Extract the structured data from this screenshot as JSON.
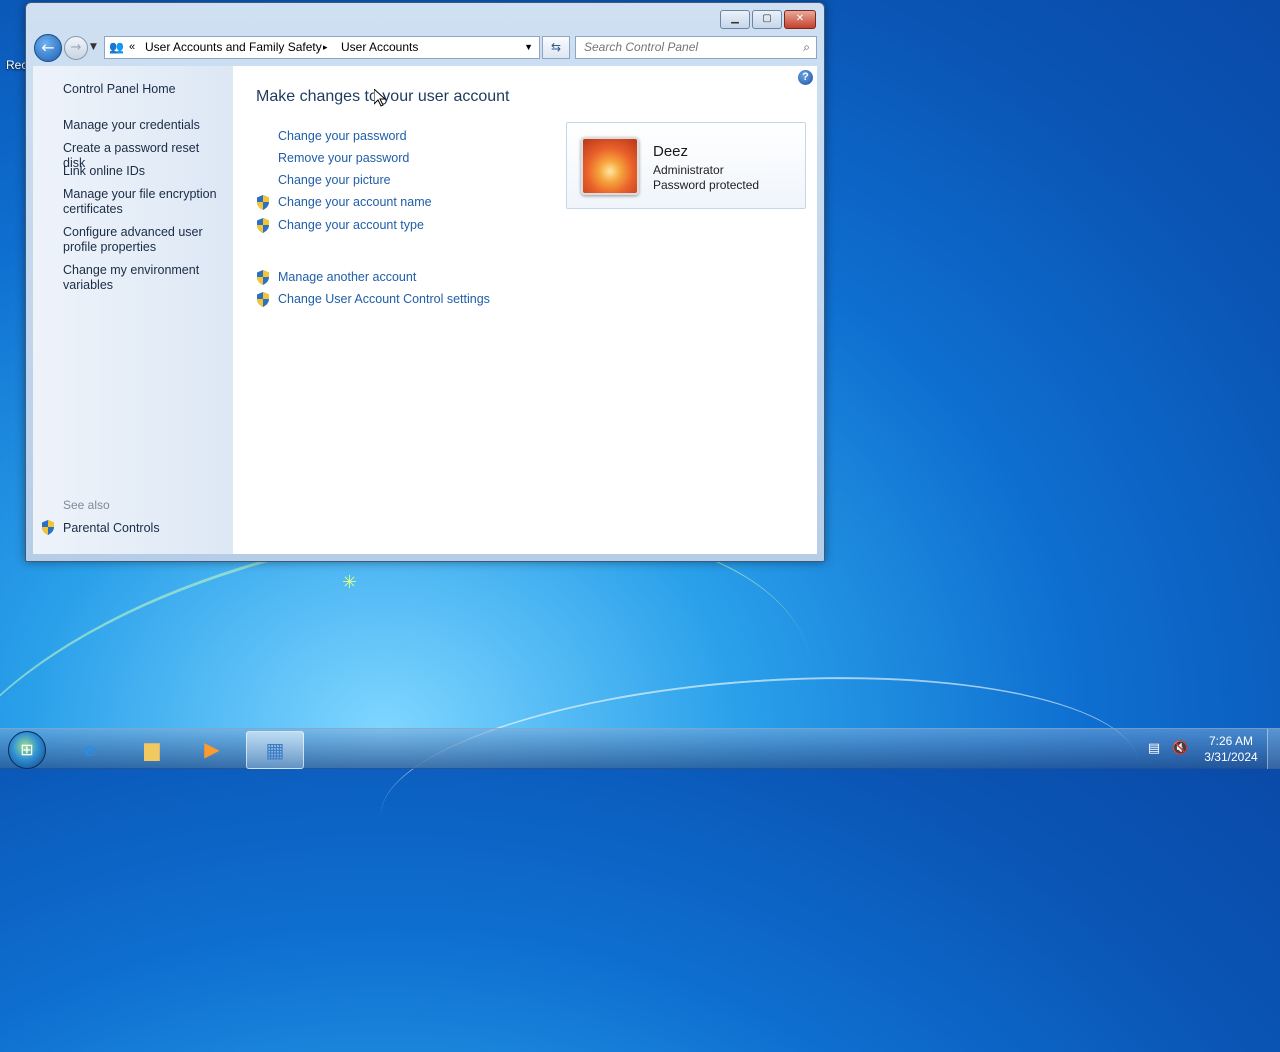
{
  "desktop": {
    "partial_label": "Rec"
  },
  "window": {
    "controls": {
      "minimize": "▁",
      "maximize": "▢",
      "close": "✕"
    },
    "nav": {
      "back": "←",
      "forward": "→",
      "address_chevron": "«",
      "breadcrumb": [
        "User Accounts and Family Safety",
        "User Accounts"
      ],
      "separator": "▸",
      "search_placeholder": "Search Control Panel"
    },
    "left_pane": {
      "links": [
        "Control Panel Home",
        "Manage your credentials",
        "Create a password reset disk",
        "Link online IDs",
        "Manage your file encryption certificates",
        "Configure advanced user profile properties",
        "Change my environment variables"
      ],
      "see_also_label": "See also",
      "see_also_links": [
        "Parental Controls"
      ]
    },
    "main": {
      "title": "Make changes to your user account",
      "tasks": [
        "Change your password",
        "Remove your password",
        "Change your picture",
        "Change your account name",
        "Change your account type"
      ],
      "admin_tasks": [
        "Manage another account",
        "Change User Account Control settings"
      ],
      "account": {
        "name": "Deez",
        "role": "Administrator",
        "status": "Password protected"
      },
      "help": "?"
    }
  },
  "taskbar": {
    "clock": {
      "time": "7:26 AM",
      "date": "3/31/2024"
    },
    "apps": [
      "internet-explorer-icon",
      "file-explorer-icon",
      "media-player-icon",
      "control-panel-icon"
    ]
  }
}
